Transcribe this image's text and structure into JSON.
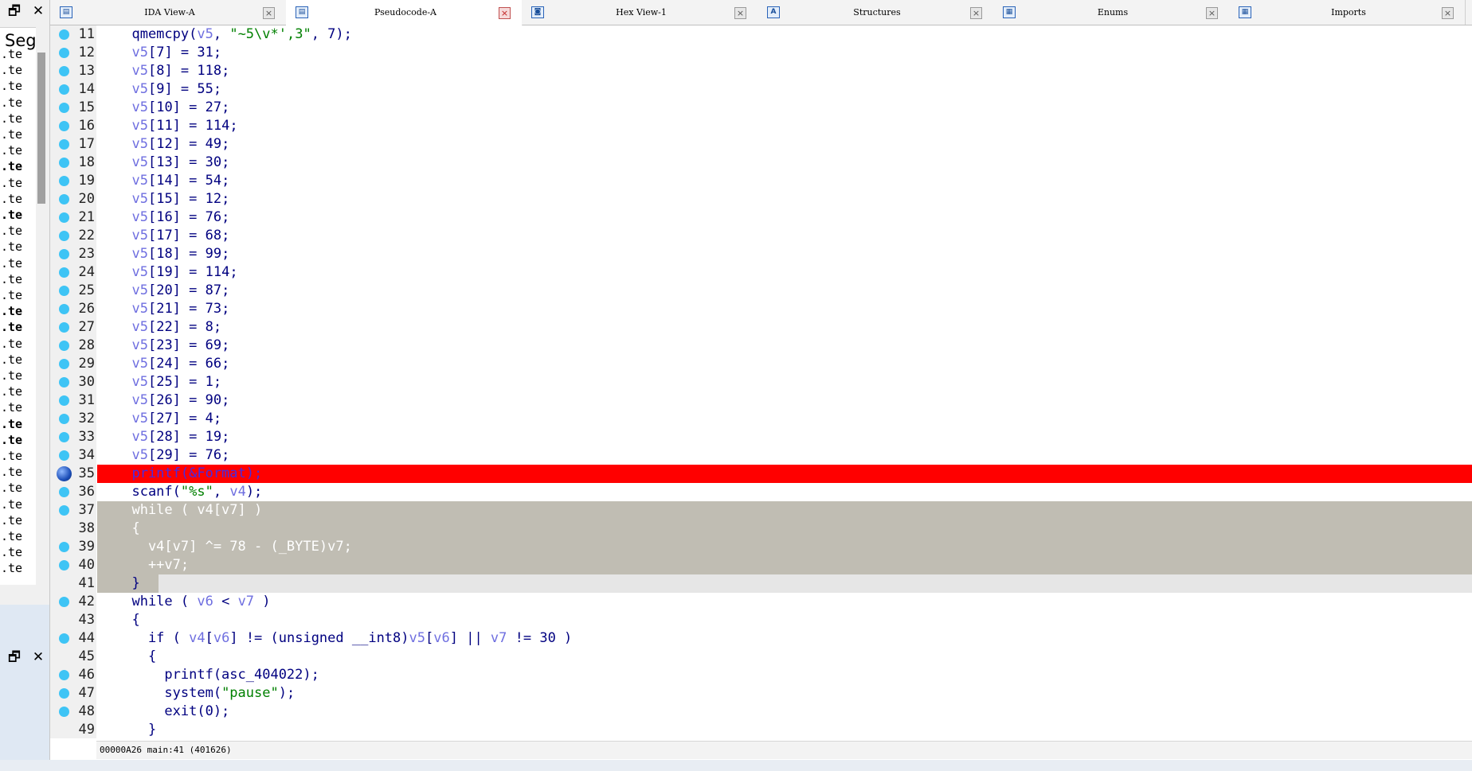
{
  "left_panel": {
    "restore_glyph": "🗗",
    "close_glyph": "✕",
    "segments_header": "Seg",
    "rows": [
      ".te",
      ".te",
      ".te",
      ".te",
      ".te",
      ".te",
      ".te",
      ".te",
      ".te",
      ".te",
      ".te",
      ".te",
      ".te",
      ".te",
      ".te",
      ".te",
      ".te",
      ".te",
      ".te",
      ".te",
      ".te",
      ".te",
      ".te",
      ".te",
      ".te",
      ".te",
      ".te",
      ".te",
      ".te",
      ".te",
      ".te",
      ".te",
      ".te"
    ],
    "bold_rows": [
      7,
      10,
      16,
      17,
      23,
      24
    ]
  },
  "tabs": [
    {
      "label": "IDA View-A",
      "icon": "ida-view-icon",
      "active": false
    },
    {
      "label": "Pseudocode-A",
      "icon": "pseudocode-icon",
      "active": true
    },
    {
      "label": "Hex View-1",
      "icon": "hex-view-icon",
      "active": false
    },
    {
      "label": "Structures",
      "icon": "structures-icon",
      "active": false
    },
    {
      "label": "Enums",
      "icon": "enums-icon",
      "active": false
    },
    {
      "label": "Imports",
      "icon": "imports-icon",
      "active": false
    }
  ],
  "code": {
    "lines": [
      {
        "num": "11",
        "marker": "dot",
        "text": "  qmemcpy(v5, \"~5\\v*',3\", 7);"
      },
      {
        "num": "12",
        "marker": "dot",
        "text": "  v5[7] = 31;"
      },
      {
        "num": "13",
        "marker": "dot",
        "text": "  v5[8] = 118;"
      },
      {
        "num": "14",
        "marker": "dot",
        "text": "  v5[9] = 55;"
      },
      {
        "num": "15",
        "marker": "dot",
        "text": "  v5[10] = 27;"
      },
      {
        "num": "16",
        "marker": "dot",
        "text": "  v5[11] = 114;"
      },
      {
        "num": "17",
        "marker": "dot",
        "text": "  v5[12] = 49;"
      },
      {
        "num": "18",
        "marker": "dot",
        "text": "  v5[13] = 30;"
      },
      {
        "num": "19",
        "marker": "dot",
        "text": "  v5[14] = 54;"
      },
      {
        "num": "20",
        "marker": "dot",
        "text": "  v5[15] = 12;"
      },
      {
        "num": "21",
        "marker": "dot",
        "text": "  v5[16] = 76;"
      },
      {
        "num": "22",
        "marker": "dot",
        "text": "  v5[17] = 68;"
      },
      {
        "num": "23",
        "marker": "dot",
        "text": "  v5[18] = 99;"
      },
      {
        "num": "24",
        "marker": "dot",
        "text": "  v5[19] = 114;"
      },
      {
        "num": "25",
        "marker": "dot",
        "text": "  v5[20] = 87;"
      },
      {
        "num": "26",
        "marker": "dot",
        "text": "  v5[21] = 73;"
      },
      {
        "num": "27",
        "marker": "dot",
        "text": "  v5[22] = 8;"
      },
      {
        "num": "28",
        "marker": "dot",
        "text": "  v5[23] = 69;"
      },
      {
        "num": "29",
        "marker": "dot",
        "text": "  v5[24] = 66;"
      },
      {
        "num": "30",
        "marker": "dot",
        "text": "  v5[25] = 1;"
      },
      {
        "num": "31",
        "marker": "dot",
        "text": "  v5[26] = 90;"
      },
      {
        "num": "32",
        "marker": "dot",
        "text": "  v5[27] = 4;"
      },
      {
        "num": "33",
        "marker": "dot",
        "text": "  v5[28] = 19;"
      },
      {
        "num": "34",
        "marker": "dot",
        "text": "  v5[29] = 76;"
      },
      {
        "num": "35",
        "marker": "breakpoint",
        "highlight": "breakpoint",
        "text": "  printf(&Format);"
      },
      {
        "num": "36",
        "marker": "dot",
        "text": "  scanf(\"%s\", v4);"
      },
      {
        "num": "37",
        "marker": "dot",
        "highlight": "selection",
        "text": "  while ( v4[v7] )"
      },
      {
        "num": "38",
        "marker": "none",
        "highlight": "selection",
        "text": "  {"
      },
      {
        "num": "39",
        "marker": "dot",
        "highlight": "selection",
        "text": "    v4[v7] ^= 78 - (_BYTE)v7;"
      },
      {
        "num": "40",
        "marker": "dot",
        "highlight": "selection",
        "text": "    ++v7;"
      },
      {
        "num": "41",
        "marker": "none",
        "highlight": "current",
        "text": "  }"
      },
      {
        "num": "42",
        "marker": "dot",
        "text": "  while ( v6 < v7 )"
      },
      {
        "num": "43",
        "marker": "none",
        "text": "  {"
      },
      {
        "num": "44",
        "marker": "dot",
        "text": "    if ( v4[v6] != (unsigned __int8)v5[v6] || v7 != 30 )"
      },
      {
        "num": "45",
        "marker": "none",
        "text": "    {"
      },
      {
        "num": "46",
        "marker": "dot",
        "text": "      printf(asc_404022);"
      },
      {
        "num": "47",
        "marker": "dot",
        "text": "      system(\"pause\");"
      },
      {
        "num": "48",
        "marker": "dot",
        "text": "      exit(0);"
      },
      {
        "num": "49",
        "marker": "none",
        "text": "    }"
      }
    ]
  },
  "status_bar": {
    "text": "00000A26 main:41 (401626)"
  },
  "colors": {
    "breakpoint_line": "#ff0000",
    "selection": "#c0bdb3",
    "line_dot": "#3ec4f5",
    "code_text": "#000080",
    "variable": "#6f6fe0",
    "string": "#008000"
  }
}
